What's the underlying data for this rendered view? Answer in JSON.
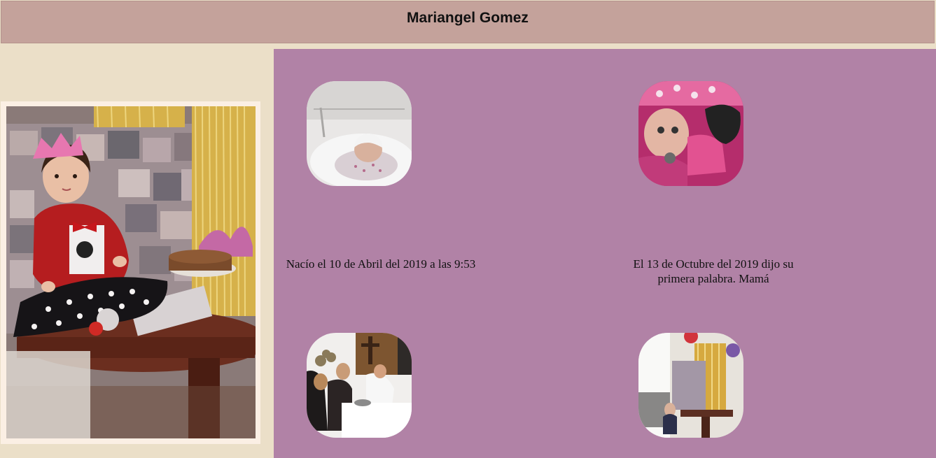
{
  "header": {
    "title": "Mariangel Gomez"
  },
  "portrait": {
    "alt": "baby-birthday-portrait"
  },
  "timeline": [
    {
      "caption": "Nacío el 10 de Abril del 2019 a las 9:53",
      "image": "newborn-photo"
    },
    {
      "caption": "El 13 de Octubre del 2019 dijo su primera palabra. Mamá",
      "image": "baby-pink-outfit-photo"
    },
    {
      "caption": "",
      "image": "baptism-church-photo"
    },
    {
      "caption": "",
      "image": "birthday-party-photo"
    }
  ],
  "colors": {
    "header_bg": "#c4a29b",
    "page_bg": "#ebdfc8",
    "main_bg": "#b182a6",
    "frame_bg": "#fbefe4"
  }
}
